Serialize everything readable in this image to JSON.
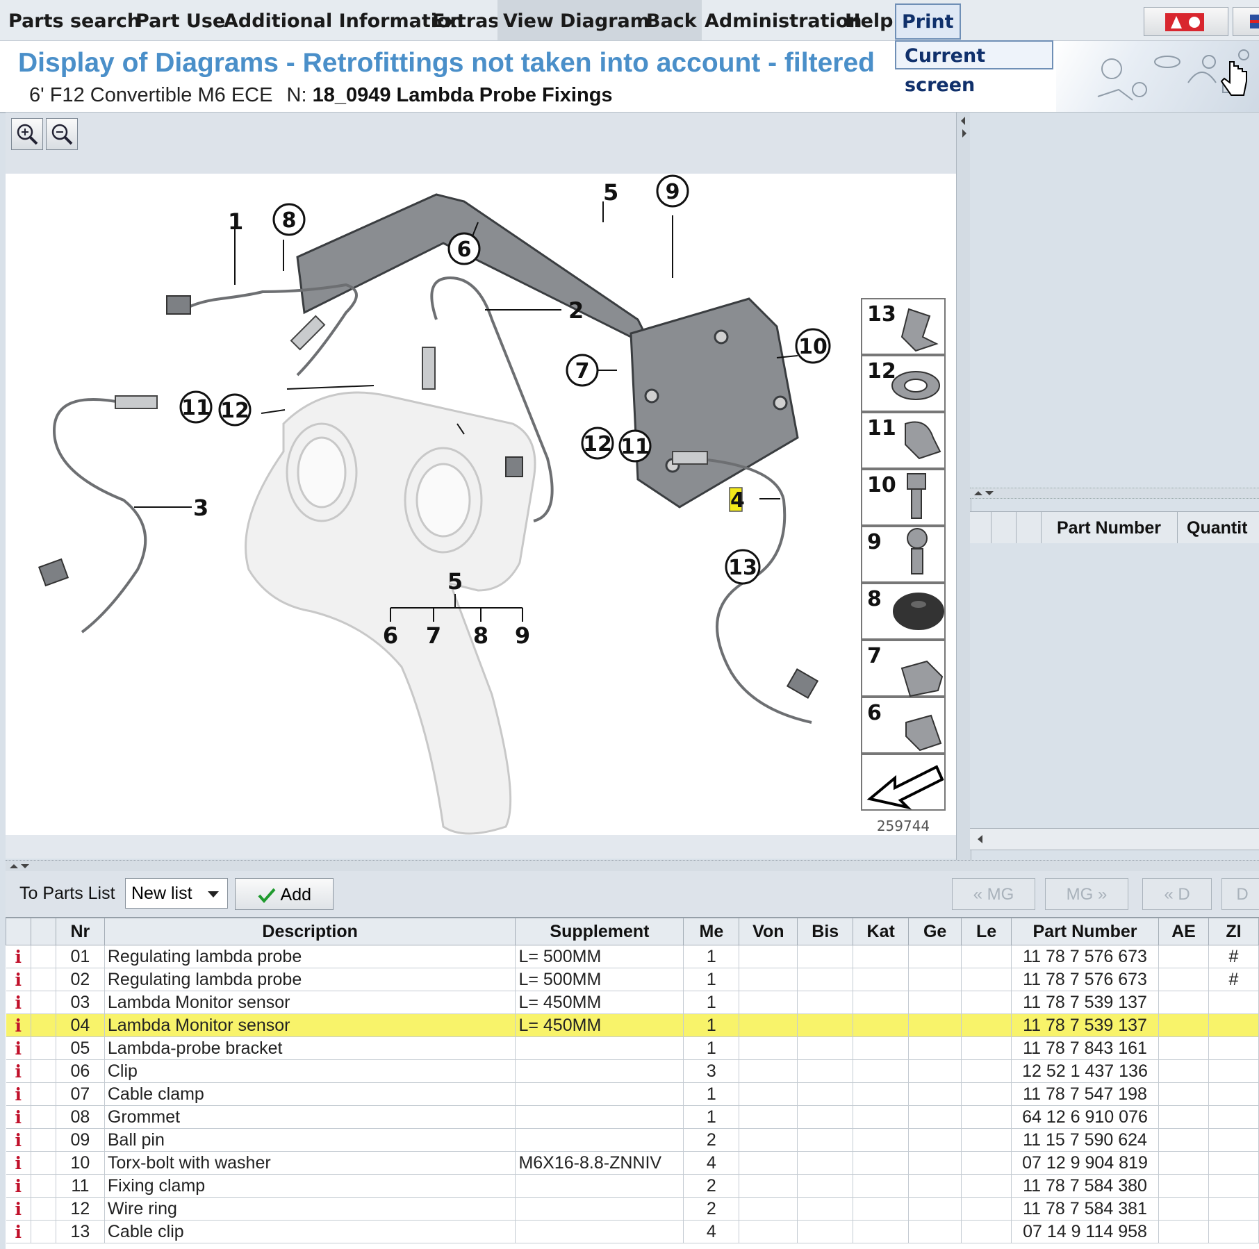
{
  "menu": {
    "items": [
      {
        "label": "Parts search"
      },
      {
        "label": "Part Use"
      },
      {
        "label": "Additional Information"
      },
      {
        "label": "Extras"
      },
      {
        "label": "View"
      },
      {
        "label": "Diagram"
      },
      {
        "label": "Back"
      },
      {
        "label": "Administration"
      },
      {
        "label": "Help"
      },
      {
        "label": "Print"
      }
    ],
    "print_dropdown": "Current screen"
  },
  "header": {
    "title": "Display of Diagrams - Retrofittings not taken into account - filtered",
    "vehicle": "6' F12 Convertible M6 ECE",
    "number_prefix": "N:",
    "diagram_name": "18_0949 Lambda Probe Fixings"
  },
  "diagram": {
    "image_number": "259744",
    "callouts": [
      "1",
      "2",
      "3",
      "4",
      "5",
      "6",
      "7",
      "8",
      "9",
      "10",
      "11",
      "12",
      "13"
    ],
    "legend_items": [
      "13",
      "12",
      "11",
      "10",
      "9",
      "8",
      "7",
      "6"
    ],
    "group_label": "5",
    "group_members": [
      "6",
      "7",
      "8",
      "9"
    ],
    "highlighted_callout": "4"
  },
  "right_panel": {
    "columns": [
      "Part Number",
      "Quantit"
    ]
  },
  "list_toolbar": {
    "to_parts_list": "To Parts List",
    "list_select": "New list",
    "add_label": "Add",
    "nav": [
      "« MG",
      "MG »",
      "« D",
      "D"
    ]
  },
  "table": {
    "columns": [
      "",
      "",
      "Nr",
      "Description",
      "Supplement",
      "Me",
      "Von",
      "Bis",
      "Kat",
      "Ge",
      "Le",
      "Part Number",
      "AE",
      "ZI"
    ],
    "info_glyph": "i",
    "rows": [
      {
        "nr": "01",
        "desc": "Regulating lambda probe",
        "supp": "L= 500MM",
        "me": "1",
        "pn": "11 78 7 576 673",
        "zi": "#"
      },
      {
        "nr": "02",
        "desc": "Regulating lambda probe",
        "supp": "L= 500MM",
        "me": "1",
        "pn": "11 78 7 576 673",
        "zi": "#"
      },
      {
        "nr": "03",
        "desc": "Lambda Monitor sensor",
        "supp": "L= 450MM",
        "me": "1",
        "pn": "11 78 7 539 137",
        "zi": ""
      },
      {
        "nr": "04",
        "desc": "Lambda Monitor sensor",
        "supp": "L= 450MM",
        "me": "1",
        "pn": "11 78 7 539 137",
        "zi": "",
        "highlight": true
      },
      {
        "nr": "05",
        "desc": "Lambda-probe bracket",
        "supp": "",
        "me": "1",
        "pn": "11 78 7 843 161",
        "zi": ""
      },
      {
        "nr": "06",
        "desc": "Clip",
        "supp": "",
        "me": "3",
        "pn": "12 52 1 437 136",
        "zi": ""
      },
      {
        "nr": "07",
        "desc": "Cable clamp",
        "supp": "",
        "me": "1",
        "pn": "11 78 7 547 198",
        "zi": ""
      },
      {
        "nr": "08",
        "desc": "Grommet",
        "supp": "",
        "me": "1",
        "pn": "64 12 6 910 076",
        "zi": ""
      },
      {
        "nr": "09",
        "desc": "Ball pin",
        "supp": "",
        "me": "2",
        "pn": "11 15 7 590 624",
        "zi": ""
      },
      {
        "nr": "10",
        "desc": "Torx-bolt with washer",
        "supp": "M6X16-8.8-ZNNIV",
        "me": "4",
        "pn": "07 12 9 904 819",
        "zi": ""
      },
      {
        "nr": "11",
        "desc": "Fixing clamp",
        "supp": "",
        "me": "2",
        "pn": "11 78 7 584 380",
        "zi": ""
      },
      {
        "nr": "12",
        "desc": "Wire ring",
        "supp": "",
        "me": "2",
        "pn": "11 78 7 584 381",
        "zi": ""
      },
      {
        "nr": "13",
        "desc": "Cable clip",
        "supp": "",
        "me": "4",
        "pn": "07 14 9 114 958",
        "zi": ""
      }
    ]
  }
}
